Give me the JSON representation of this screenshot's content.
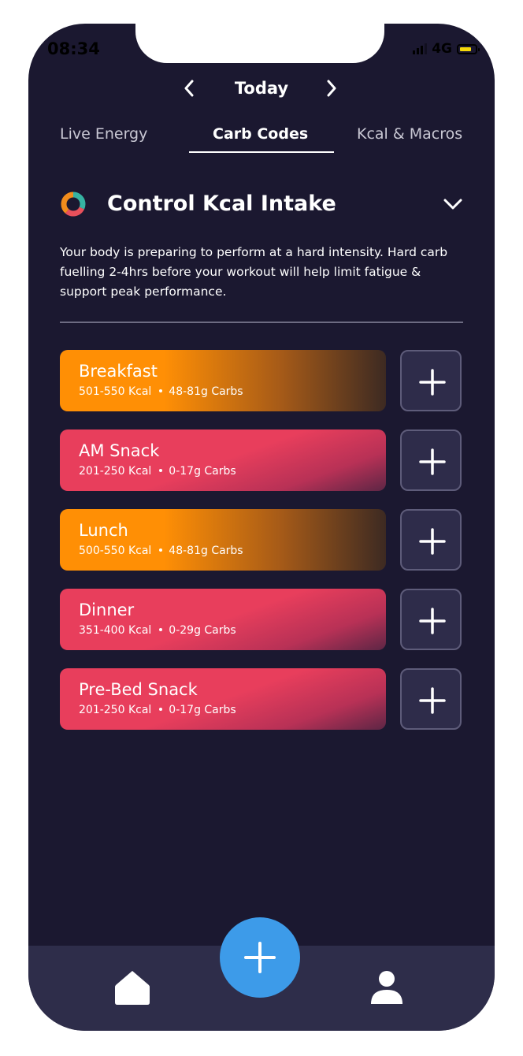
{
  "status_bar": {
    "time": "08:34",
    "network": "4G"
  },
  "date_nav": {
    "title": "Today",
    "prev_icon": "chevron-left-icon",
    "next_icon": "chevron-right-icon"
  },
  "tabs": [
    {
      "label": "Live Energy",
      "active": false
    },
    {
      "label": "Carb Codes",
      "active": true
    },
    {
      "label": "Kcal & Macros",
      "active": false
    }
  ],
  "section": {
    "title": "Control Kcal Intake",
    "description": "Your body is preparing to perform at a hard intensity. Hard carb fuelling 2-4hrs before your workout will help limit fatigue & support peak performance."
  },
  "meals": [
    {
      "name": "Breakfast",
      "kcal": "501-550 Kcal",
      "carbs": "48-81g Carbs",
      "color": "orange"
    },
    {
      "name": "AM Snack",
      "kcal": "201-250 Kcal",
      "carbs": "0-17g Carbs",
      "color": "red"
    },
    {
      "name": "Lunch",
      "kcal": "500-550 Kcal",
      "carbs": "48-81g Carbs",
      "color": "orange"
    },
    {
      "name": "Dinner",
      "kcal": "351-400 Kcal",
      "carbs": "0-29g Carbs",
      "color": "red"
    },
    {
      "name": "Pre-Bed Snack",
      "kcal": "201-250 Kcal",
      "carbs": "0-17g Carbs",
      "color": "red"
    }
  ],
  "colors": {
    "background": "#1b1830",
    "orange": "#ff8f05",
    "red": "#e83e5c",
    "fab": "#3d9be9",
    "nav_bar": "#2e2d4a"
  },
  "bottom_nav": {
    "home_icon": "home-icon",
    "add_icon": "plus-icon",
    "profile_icon": "user-icon"
  }
}
